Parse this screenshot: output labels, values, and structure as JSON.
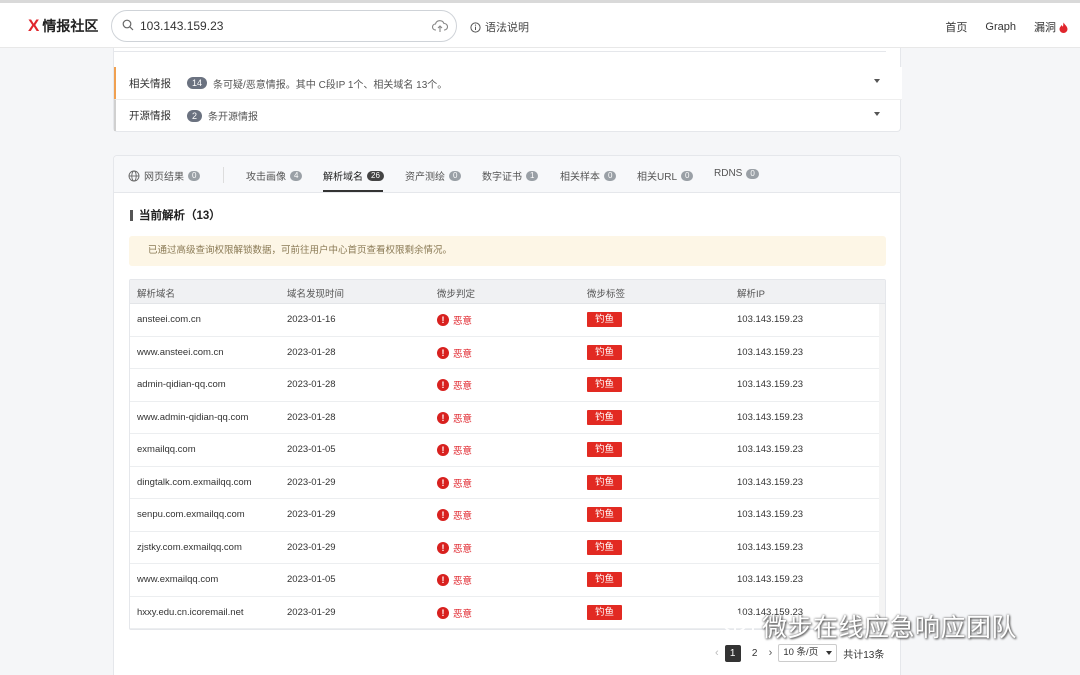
{
  "brand": {
    "logo_mark": "X",
    "name": "情报社区"
  },
  "search": {
    "value": "103.143.159.23"
  },
  "header": {
    "syntax_help": "语法说明"
  },
  "nav": {
    "home": "首页",
    "graph": "Graph",
    "vuln": "漏洞"
  },
  "intel_panel": {
    "related": {
      "label": "相关情报",
      "count": "14",
      "desc": "条可疑/恶意情报。其中 C段IP 1个、相关域名 13个。"
    },
    "open_source": {
      "label": "开源情报",
      "count": "2",
      "desc": "条开源情报"
    }
  },
  "tabs": [
    {
      "label": "网页结果",
      "count": "0"
    },
    {
      "label": "攻击画像",
      "count": "4"
    },
    {
      "label": "解析域名",
      "count": "26"
    },
    {
      "label": "资产测绘",
      "count": "0"
    },
    {
      "label": "数字证书",
      "count": "1"
    },
    {
      "label": "相关样本",
      "count": "0"
    },
    {
      "label": "相关URL",
      "count": "0"
    },
    {
      "label": "RDNS",
      "count": "0"
    }
  ],
  "section": {
    "title": "当前解析（13）",
    "notice": "已通过高级查询权限解锁数据，可前往用户中心首页查看权限剩余情况。"
  },
  "table": {
    "headers": [
      "解析域名",
      "域名发现时间",
      "微步判定",
      "微步标签",
      "解析IP"
    ],
    "rows": [
      {
        "domain": "ansteei.com.cn",
        "date": "2023-01-16",
        "verdict": "恶意",
        "tag": "钓鱼",
        "ip": "103.143.159.23"
      },
      {
        "domain": "www.ansteei.com.cn",
        "date": "2023-01-28",
        "verdict": "恶意",
        "tag": "钓鱼",
        "ip": "103.143.159.23"
      },
      {
        "domain": "admin-qidian-qq.com",
        "date": "2023-01-28",
        "verdict": "恶意",
        "tag": "钓鱼",
        "ip": "103.143.159.23"
      },
      {
        "domain": "www.admin-qidian-qq.com",
        "date": "2023-01-28",
        "verdict": "恶意",
        "tag": "钓鱼",
        "ip": "103.143.159.23"
      },
      {
        "domain": "exmailqq.com",
        "date": "2023-01-05",
        "verdict": "恶意",
        "tag": "钓鱼",
        "ip": "103.143.159.23"
      },
      {
        "domain": "dingtalk.com.exmailqq.com",
        "date": "2023-01-29",
        "verdict": "恶意",
        "tag": "钓鱼",
        "ip": "103.143.159.23"
      },
      {
        "domain": "senpu.com.exmailqq.com",
        "date": "2023-01-29",
        "verdict": "恶意",
        "tag": "钓鱼",
        "ip": "103.143.159.23"
      },
      {
        "domain": "zjstky.com.exmailqq.com",
        "date": "2023-01-29",
        "verdict": "恶意",
        "tag": "钓鱼",
        "ip": "103.143.159.23"
      },
      {
        "domain": "www.exmailqq.com",
        "date": "2023-01-05",
        "verdict": "恶意",
        "tag": "钓鱼",
        "ip": "103.143.159.23"
      },
      {
        "domain": "hxxy.edu.cn.icoremail.net",
        "date": "2023-01-29",
        "verdict": "恶意",
        "tag": "钓鱼",
        "ip": "103.143.159.23"
      }
    ]
  },
  "pagination": {
    "page1": "1",
    "page2": "2",
    "page_size": "10 条/页",
    "total": "共计13条"
  },
  "watermark": {
    "text": "微步在线应急响应团队"
  },
  "colors": {
    "brand_red": "#e0262d",
    "tag_red": "#e22a22",
    "accent_orange": "#f0a050"
  },
  "icons": {
    "search": "search-icon",
    "cloud_upload": "cloud-upload-icon",
    "info": "info-icon",
    "fire": "fire-icon",
    "globe": "globe-icon",
    "alert": "alert-circle-icon",
    "chevron": "chevron-down-icon",
    "wechat": "wechat-icon"
  }
}
